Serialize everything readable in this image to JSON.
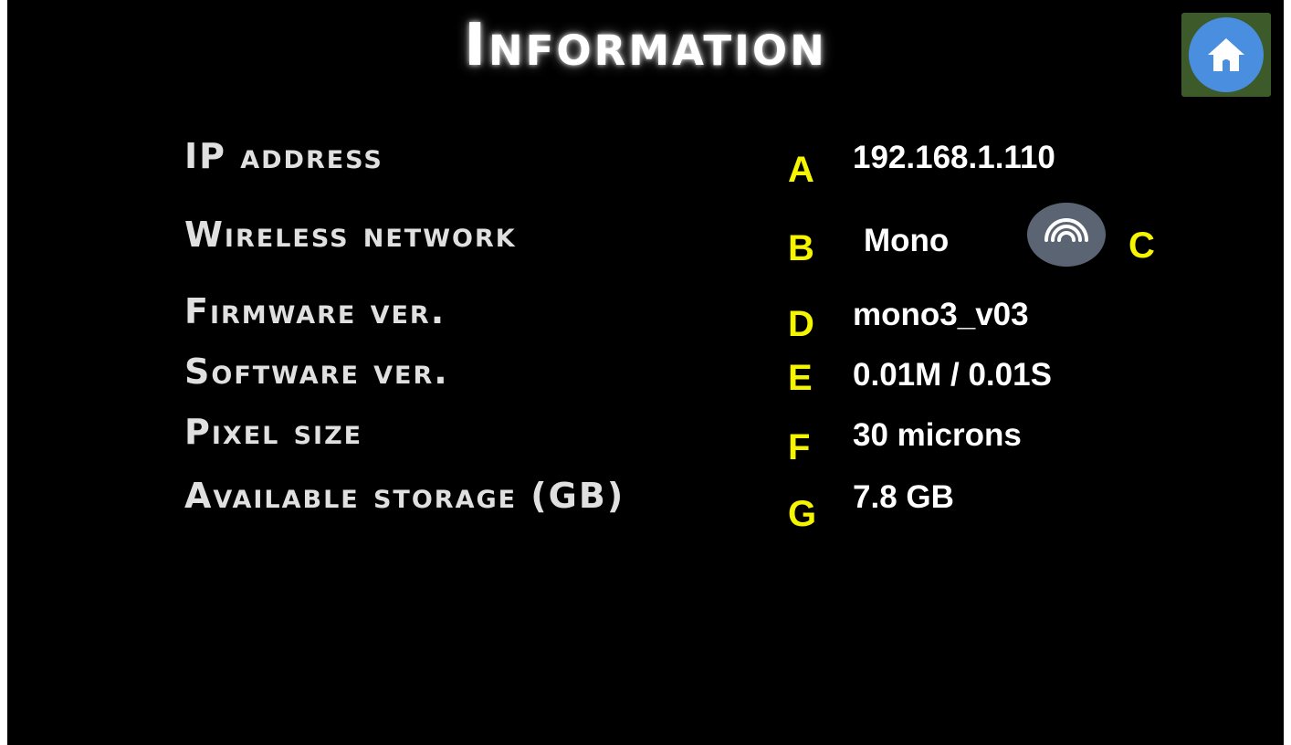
{
  "header": {
    "title": "Information",
    "home_icon": "home-icon"
  },
  "rows": [
    {
      "label": "IP address",
      "marker": "A",
      "value": "192.168.1.110"
    },
    {
      "label": "Wireless network",
      "marker": "B",
      "value": "Mono"
    },
    {
      "label": "Firmware ver.",
      "marker": "D",
      "value": "mono3_v03"
    },
    {
      "label": "Software ver.",
      "marker": "E",
      "value": "0.01M / 0.01S"
    },
    {
      "label": "Pixel size",
      "marker": "F",
      "value": "30 microns"
    },
    {
      "label": "Available storage (GB)",
      "marker": "G",
      "value": "7.8 GB"
    }
  ],
  "wireless": {
    "icon": "wireless-signal-icon",
    "marker": "C"
  },
  "colors": {
    "background": "#000000",
    "marker": "#f5f500",
    "home_button": "#4a8ee0"
  }
}
